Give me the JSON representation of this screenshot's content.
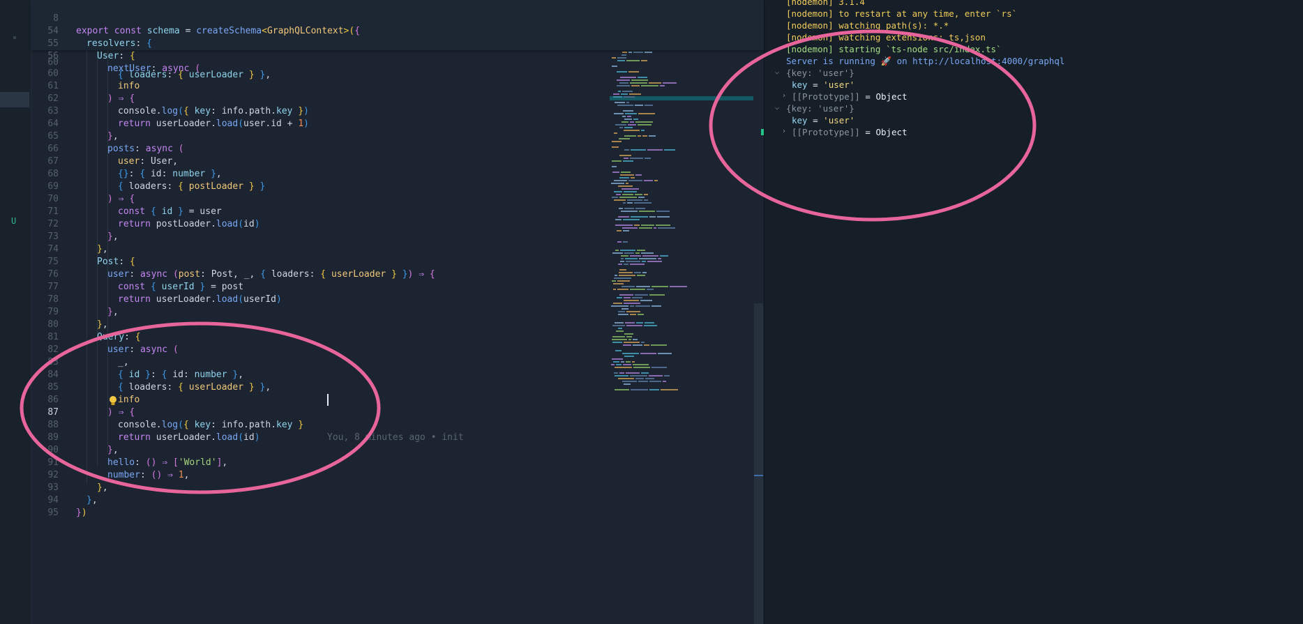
{
  "activity_bar": {
    "scm_status_letter": "U"
  },
  "editor": {
    "blame_text": "You, 8 minutes ago • init",
    "lines": {
      "l8": "8",
      "l54": "54",
      "l55": "55",
      "l56": "56",
      "l60": "60",
      "l61": "61",
      "l62": "62",
      "l63": "63",
      "l64": "64",
      "l65": "65",
      "l66": "66",
      "l67": "67",
      "l68": "68",
      "l69": "69",
      "l70": "70",
      "l71": "71",
      "l72": "72",
      "l73": "73",
      "l74": "74",
      "l75": "75",
      "l76": "76",
      "l77": "77",
      "l78": "78",
      "l79": "79",
      "l80": "80",
      "l81": "81",
      "l82": "82",
      "l83": "83",
      "l84": "84",
      "l85": "85",
      "l86": "86",
      "l87": "87",
      "l88": "88",
      "l89": "89",
      "l90": "90",
      "l91": "91",
      "l92": "92",
      "l93": "93",
      "l94": "94",
      "l95": "95"
    },
    "tok": {
      "export": "export",
      "const": "const",
      "schema": "schema",
      "eq": "=",
      "createSchema": "createSchema",
      "lt": "<",
      "GraphQLContext": "GraphQLContext",
      "gt": ">",
      "lparen": "(",
      "rparen": ")",
      "lbrace": "{",
      "rbrace": "}",
      "resolvers": "resolvers",
      "colon": ":",
      "User": "User",
      "nextUser": "nextUser",
      "async": "async",
      "loaders": "loaders",
      "userLoader": "userLoader",
      "info": "info",
      "arrow": "⇒",
      "console": "console",
      "dot": ".",
      "log": "log",
      "key": "key",
      "path": "path",
      "return": "return",
      "load": "load",
      "user": "user",
      "id": "id",
      "plus": "+",
      "one": "1",
      "comma": ",",
      "posts": "posts",
      "number": "number",
      "postLoader": "postLoader",
      "Post": "Post",
      "post": "post",
      "underscore": "_",
      "userId": "userId",
      "Query": "Query",
      "hello": "hello",
      "emptyparens": "()",
      "lbrack": "[",
      "rbrack": "]",
      "world": "'World'"
    }
  },
  "terminal": {
    "lines": [
      "[nodemon] 3.1.4",
      "[nodemon] to restart at any time, enter `rs`",
      "[nodemon] watching path(s): *.*",
      "[nodemon] watching extensions: ts,json",
      "[nodemon] starting `ts-node src/index.ts`"
    ],
    "server_prefix": "Server is running",
    "server_emoji": "🚀",
    "server_on": "on",
    "server_url": "http://localhost:4000/graphql",
    "log_groups": [
      {
        "summary": "{key: 'user'}",
        "key_name": "key",
        "key_eq": "=",
        "key_value": "'user'",
        "proto_label": "[[Prototype]]",
        "proto_eq": "=",
        "proto_value": "Object"
      },
      {
        "summary": "{key: 'user'}",
        "key_name": "key",
        "key_eq": "=",
        "key_value": "'user'",
        "proto_label": "[[Prototype]]",
        "proto_eq": "=",
        "proto_value": "Object"
      }
    ]
  },
  "colors": {
    "annotation_ellipse": "#e8659b",
    "background": "#1b2430"
  }
}
